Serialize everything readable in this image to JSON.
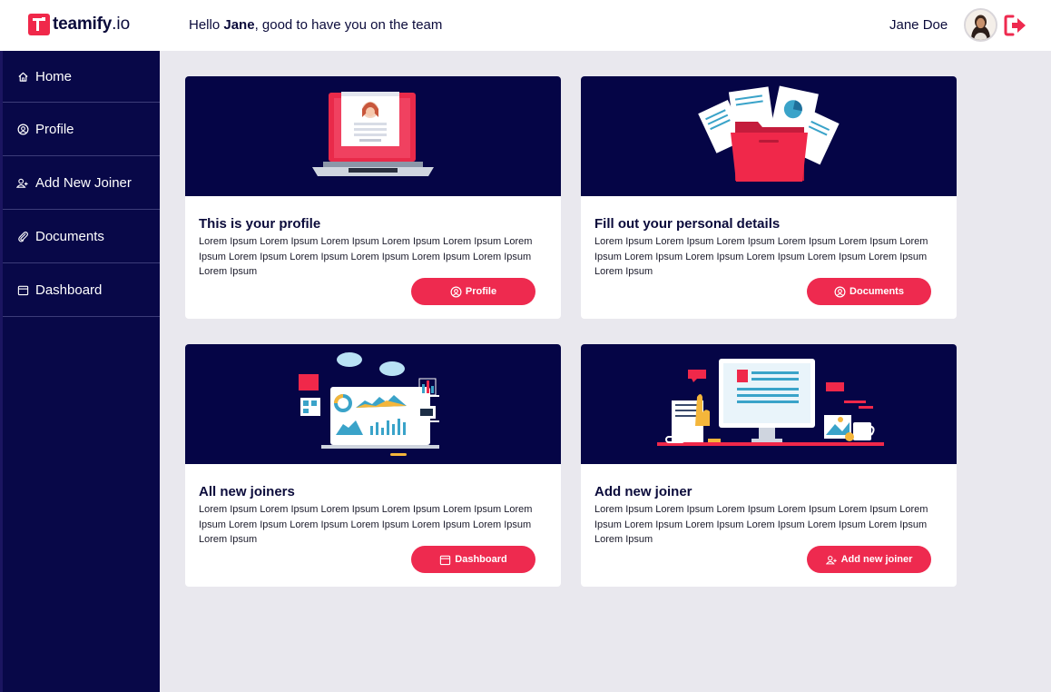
{
  "brand": {
    "name": "teamify",
    "tld": ".io"
  },
  "header": {
    "greeting_prefix": "Hello ",
    "greeting_name": "Jane",
    "greeting_suffix": ", good to have you on the team",
    "user_name": "Jane Doe"
  },
  "sidebar": {
    "items": [
      {
        "label": "Home",
        "icon": "home-icon"
      },
      {
        "label": "Profile",
        "icon": "user-circle-icon"
      },
      {
        "label": "Add New Joiner",
        "icon": "user-plus-icon"
      },
      {
        "label": "Documents",
        "icon": "paperclip-icon"
      },
      {
        "label": "Dashboard",
        "icon": "calendar-icon"
      }
    ]
  },
  "cards": [
    {
      "title": "This is your profile",
      "text": "Lorem Ipsum Lorem Ipsum Lorem Ipsum Lorem Ipsum Lorem Ipsum Lorem Ipsum Lorem Ipsum Lorem Ipsum Lorem Ipsum Lorem Ipsum Lorem Ipsum Lorem Ipsum",
      "button": "Profile",
      "button_icon": "user-circle-icon"
    },
    {
      "title": "Fill out your personal details",
      "text": "Lorem Ipsum Lorem Ipsum Lorem Ipsum Lorem Ipsum Lorem Ipsum Lorem Ipsum Lorem Ipsum Lorem Ipsum Lorem Ipsum Lorem Ipsum Lorem Ipsum Lorem Ipsum",
      "button": "Documents",
      "button_icon": "user-circle-icon"
    },
    {
      "title": "All new joiners",
      "text": "Lorem Ipsum Lorem Ipsum Lorem Ipsum Lorem Ipsum Lorem Ipsum Lorem Ipsum Lorem Ipsum Lorem Ipsum Lorem Ipsum Lorem Ipsum Lorem Ipsum Lorem Ipsum",
      "button": "Dashboard",
      "button_icon": "calendar-icon"
    },
    {
      "title": "Add new joiner",
      "text": "Lorem Ipsum Lorem Ipsum Lorem Ipsum Lorem Ipsum Lorem Ipsum Lorem Ipsum Lorem Ipsum Lorem Ipsum Lorem Ipsum Lorem Ipsum Lorem Ipsum Lorem Ipsum",
      "button": "Add new joiner",
      "button_icon": "user-plus-icon"
    }
  ],
  "colors": {
    "accent": "#ee2a4f",
    "sidebar_bg": "#080848",
    "card_image_bg": "#050546",
    "page_bg": "#e9e8ee",
    "text_dark": "#0b0b3b"
  }
}
